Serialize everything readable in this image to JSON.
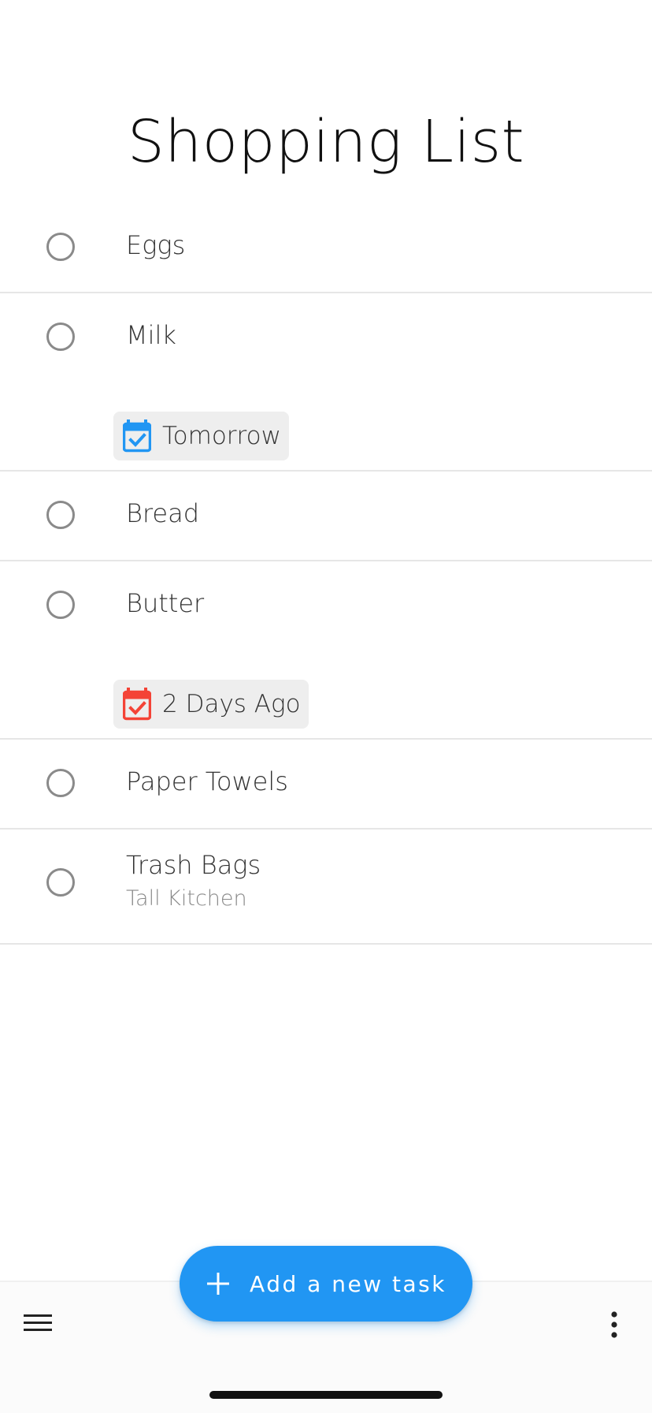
{
  "header": {
    "title": "Shopping List"
  },
  "tasks": [
    {
      "name": "Eggs",
      "completed": false
    },
    {
      "name": "Milk",
      "completed": false,
      "due": {
        "label": "Tomorrow",
        "icon": "calendar-check-icon",
        "color": "#2196f3"
      }
    },
    {
      "name": "Bread",
      "completed": false
    },
    {
      "name": "Butter",
      "completed": false,
      "due": {
        "label": "2 Days Ago",
        "icon": "calendar-check-icon",
        "color": "#f44336"
      }
    },
    {
      "name": "Paper Towels",
      "completed": false
    },
    {
      "name": "Trash Bags",
      "completed": false,
      "note": "Tall Kitchen"
    }
  ],
  "fab": {
    "label": "Add a new task",
    "icon": "plus-icon",
    "color": "#2196f3"
  },
  "bottom_bar": {
    "left_icon": "menu-icon",
    "right_icon": "more-vertical-icon"
  },
  "colors": {
    "accent": "#2196f3",
    "overdue": "#f44336",
    "checkbox": "#8a8a8a",
    "divider": "#e6e6e6",
    "chip_bg": "#eeeeee"
  }
}
